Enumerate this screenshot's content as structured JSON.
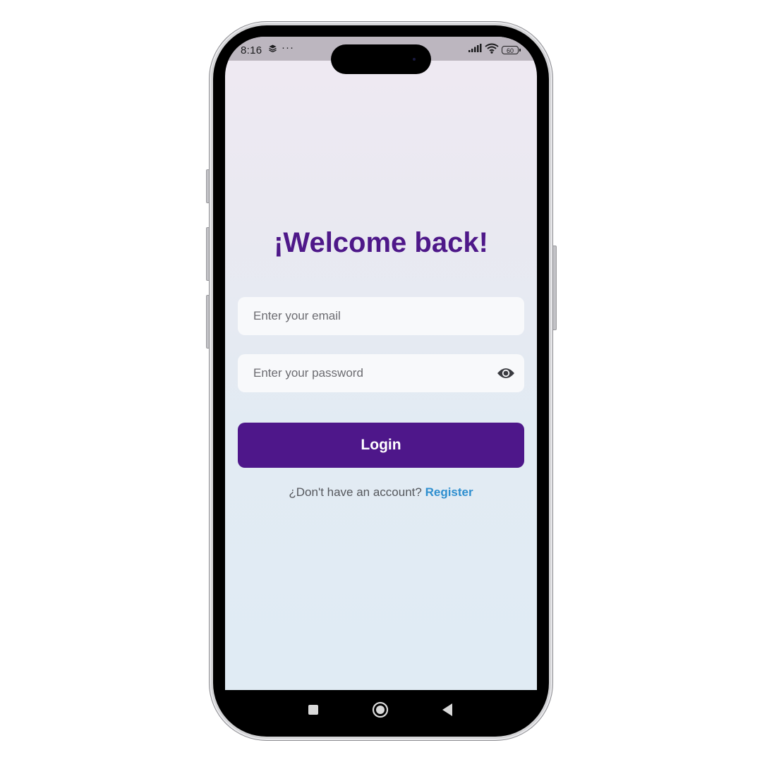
{
  "status_bar": {
    "time": "8:16",
    "more_indicator": "···",
    "battery_level": "60"
  },
  "login": {
    "title": "¡Welcome back!",
    "email_placeholder": "Enter your email",
    "password_placeholder": "Enter your password",
    "login_label": "Login",
    "no_account_text": "¿Don't have an account?",
    "register_label": "Register"
  },
  "icons": {
    "notification": "layers-icon",
    "signal": "signal-icon",
    "wifi": "wifi-icon",
    "battery": "battery-icon",
    "password_toggle": "eye-icon",
    "nav_recents": "square-icon",
    "nav_home": "circle-icon",
    "nav_back": "triangle-back-icon"
  },
  "colors": {
    "title": "#4e1889",
    "button": "#4e178a",
    "link": "#2f8fcf",
    "field_background": "#f8f9fb",
    "status_bar": "#bcb6bf"
  }
}
